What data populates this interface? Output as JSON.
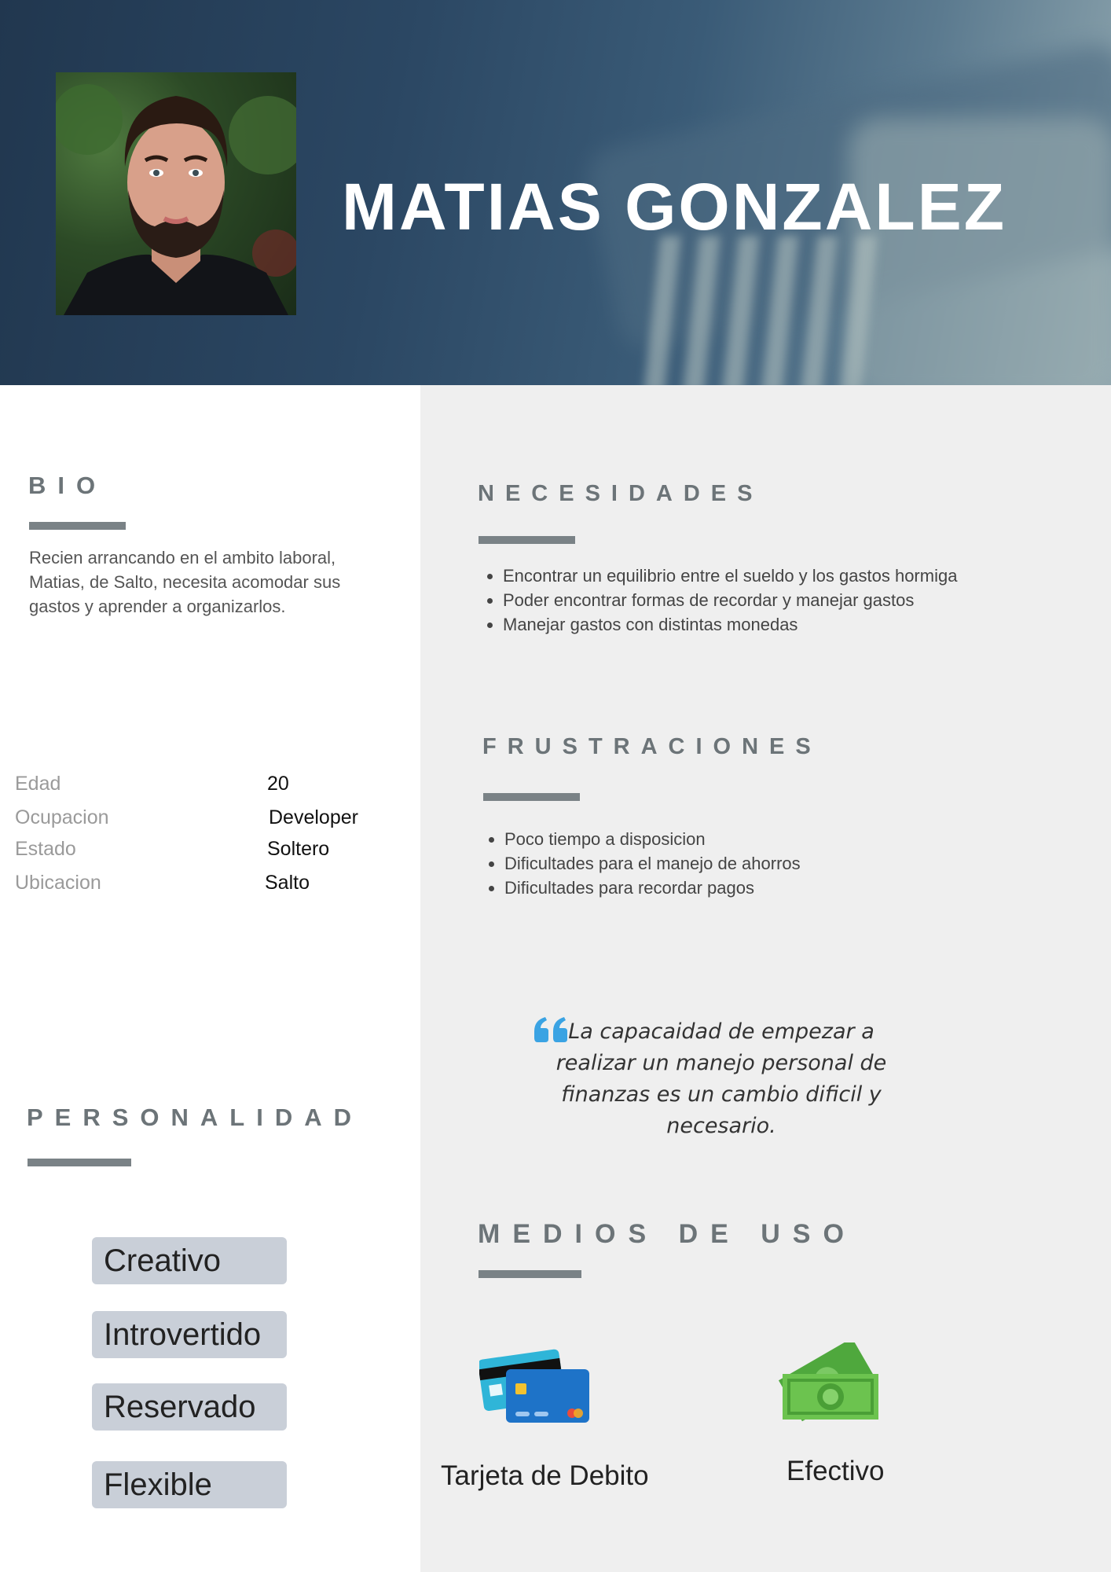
{
  "header": {
    "name": "MATIAS GONZALEZ"
  },
  "bio": {
    "title": "BIO",
    "text": "Recien arrancando en el ambito laboral, Matias, de Salto, necesita acomodar sus gastos  y  aprender a organizarlos."
  },
  "facts": [
    {
      "label": "Edad",
      "value": "20"
    },
    {
      "label": "Ocupacion",
      "value": "Developer"
    },
    {
      "label": "Estado",
      "value": "Soltero"
    },
    {
      "label": "Ubicacion",
      "value": "Salto"
    }
  ],
  "personality": {
    "title": "PERSONALIDAD",
    "traits": [
      "Creativo",
      "Introvertido",
      "Reservado",
      "Flexible"
    ]
  },
  "needs": {
    "title": "NECESIDADES",
    "items": [
      "Encontrar un equilibrio entre el sueldo y los gastos hormiga",
      "Poder encontrar formas de recordar y manejar gastos",
      "Manejar gastos con distintas monedas"
    ]
  },
  "frustrations": {
    "title": "FRUSTRACIONES",
    "items": [
      "Poco tiempo a disposicion",
      "Dificultades para el manejo de ahorros",
      "Dificultades para recordar pagos"
    ]
  },
  "quote": {
    "text": "La capacaidad de  empezar a realizar un manejo personal de finanzas es un cambio dificil y necesario.",
    "accent_color": "#3aa3e3"
  },
  "media": {
    "title": "MEDIOS  DE  USO",
    "items": [
      {
        "label": "Tarjeta de Debito",
        "icon": "credit-cards-icon"
      },
      {
        "label": "Efectivo",
        "icon": "cash-icon"
      }
    ]
  },
  "colors": {
    "header_dark": "#21374f",
    "panel_grey": "#efefef",
    "section_title": "#6c7478",
    "pill_bg": "#c9cfd8"
  }
}
